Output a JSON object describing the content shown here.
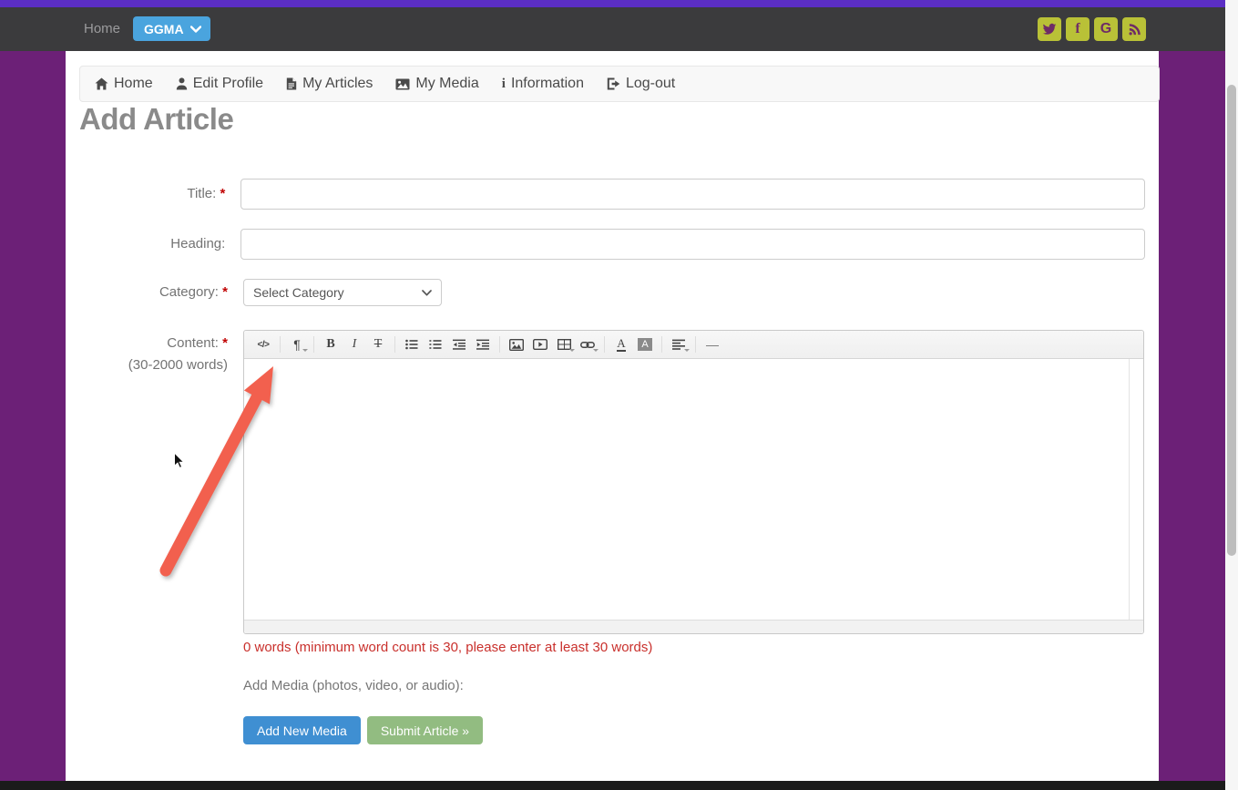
{
  "topbar": {
    "home_label": "Home",
    "brand_label": "GGMA",
    "social_glyphs": {
      "facebook": "f",
      "google": "G"
    }
  },
  "nav": {
    "items": [
      {
        "label": "Home",
        "icon": "home-icon"
      },
      {
        "label": "Edit Profile",
        "icon": "user-icon"
      },
      {
        "label": "My Articles",
        "icon": "document-icon"
      },
      {
        "label": "My Media",
        "icon": "image-icon"
      },
      {
        "label": "Information",
        "icon": "info-icon",
        "glyph": "i"
      },
      {
        "label": "Log-out",
        "icon": "logout-icon"
      }
    ]
  },
  "page_title": "Add Article",
  "form": {
    "required_marker": "*",
    "fields": {
      "title": {
        "label": "Title:",
        "value": "",
        "placeholder": ""
      },
      "heading": {
        "label": "Heading:",
        "value": "",
        "placeholder": ""
      },
      "category": {
        "label": "Category:",
        "value": "Select Category"
      },
      "content": {
        "label": "Content:",
        "sublabel": "(30-2000 words)",
        "value": ""
      }
    },
    "word_count_warning": "0 words (minimum word count is 30, please enter at least 30 words)",
    "add_media_label": "Add Media (photos, video, or audio):",
    "add_media_button": "Add New Media",
    "submit_button": "Submit Article »"
  },
  "editor": {
    "glyphs": {
      "code": "</>",
      "paragraph": "¶",
      "bold": "B",
      "italic": "I",
      "strike": "T",
      "font_color": "A",
      "highlight": "A",
      "hr": "—"
    },
    "toolbar_buttons": [
      "code-view",
      "paragraph-style",
      "bold",
      "italic",
      "strikethrough",
      "unordered-list",
      "ordered-list",
      "outdent",
      "indent",
      "insert-picture",
      "insert-video",
      "insert-table",
      "insert-link",
      "font-color",
      "highlight-color",
      "paragraph-align",
      "horizontal-rule"
    ]
  },
  "colors": {
    "top_strip": "#5B2EC4",
    "topbar": "#3B3B3D",
    "body_purple": "#6C2077",
    "brand_blue": "#4AA4DE",
    "social_olive": "#B9C137",
    "social_icon_purple": "#6E2B66",
    "warning_red": "#C9302C",
    "button_blue": "#3F8FD2",
    "button_green": "#92BC81",
    "arrow_red": "#F2604E"
  }
}
